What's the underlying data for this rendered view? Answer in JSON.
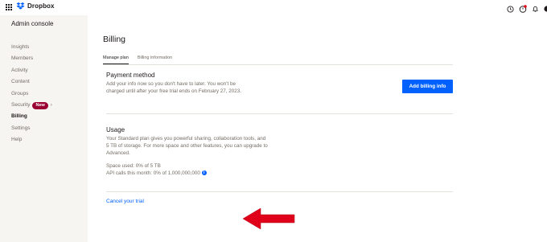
{
  "header": {
    "app_name": "Dropbox",
    "icons": [
      "apps-grid-icon",
      "dropbox-logo-icon",
      "help-icon",
      "updates-icon",
      "notifications-icon",
      "account-icon"
    ],
    "accent_color": "#0061fe"
  },
  "sidebar": {
    "title": "Admin console",
    "items": [
      {
        "label": "Insights"
      },
      {
        "label": "Members"
      },
      {
        "label": "Activity"
      },
      {
        "label": "Content"
      },
      {
        "label": "Groups"
      },
      {
        "label": "Security",
        "badge": "New"
      },
      {
        "label": "Billing",
        "active": true
      },
      {
        "label": "Settings"
      },
      {
        "label": "Help"
      }
    ]
  },
  "main": {
    "title": "Billing",
    "tabs": [
      {
        "label": "Manage plan",
        "active": true
      },
      {
        "label": "Billing information"
      }
    ],
    "payment": {
      "title": "Payment method",
      "line1": "Add your info now so you don't have to later. You won't be",
      "line2": "charged until after your free trial ends on February 27, 2023.",
      "button": "Add billing info"
    },
    "usage": {
      "title": "Usage",
      "line1": "Your Standard plan gives you powerful sharing, collaboration tools, and",
      "line2": "5 TB of storage. For more space and other features, you can upgrade to",
      "line3": "Advanced.",
      "space": "Space used: 0% of 5 TB",
      "api": "API calls this month: 0% of 1,000,000,000"
    },
    "cancel_link": "Cancel your trial",
    "annotation_color": "#e0001a"
  }
}
